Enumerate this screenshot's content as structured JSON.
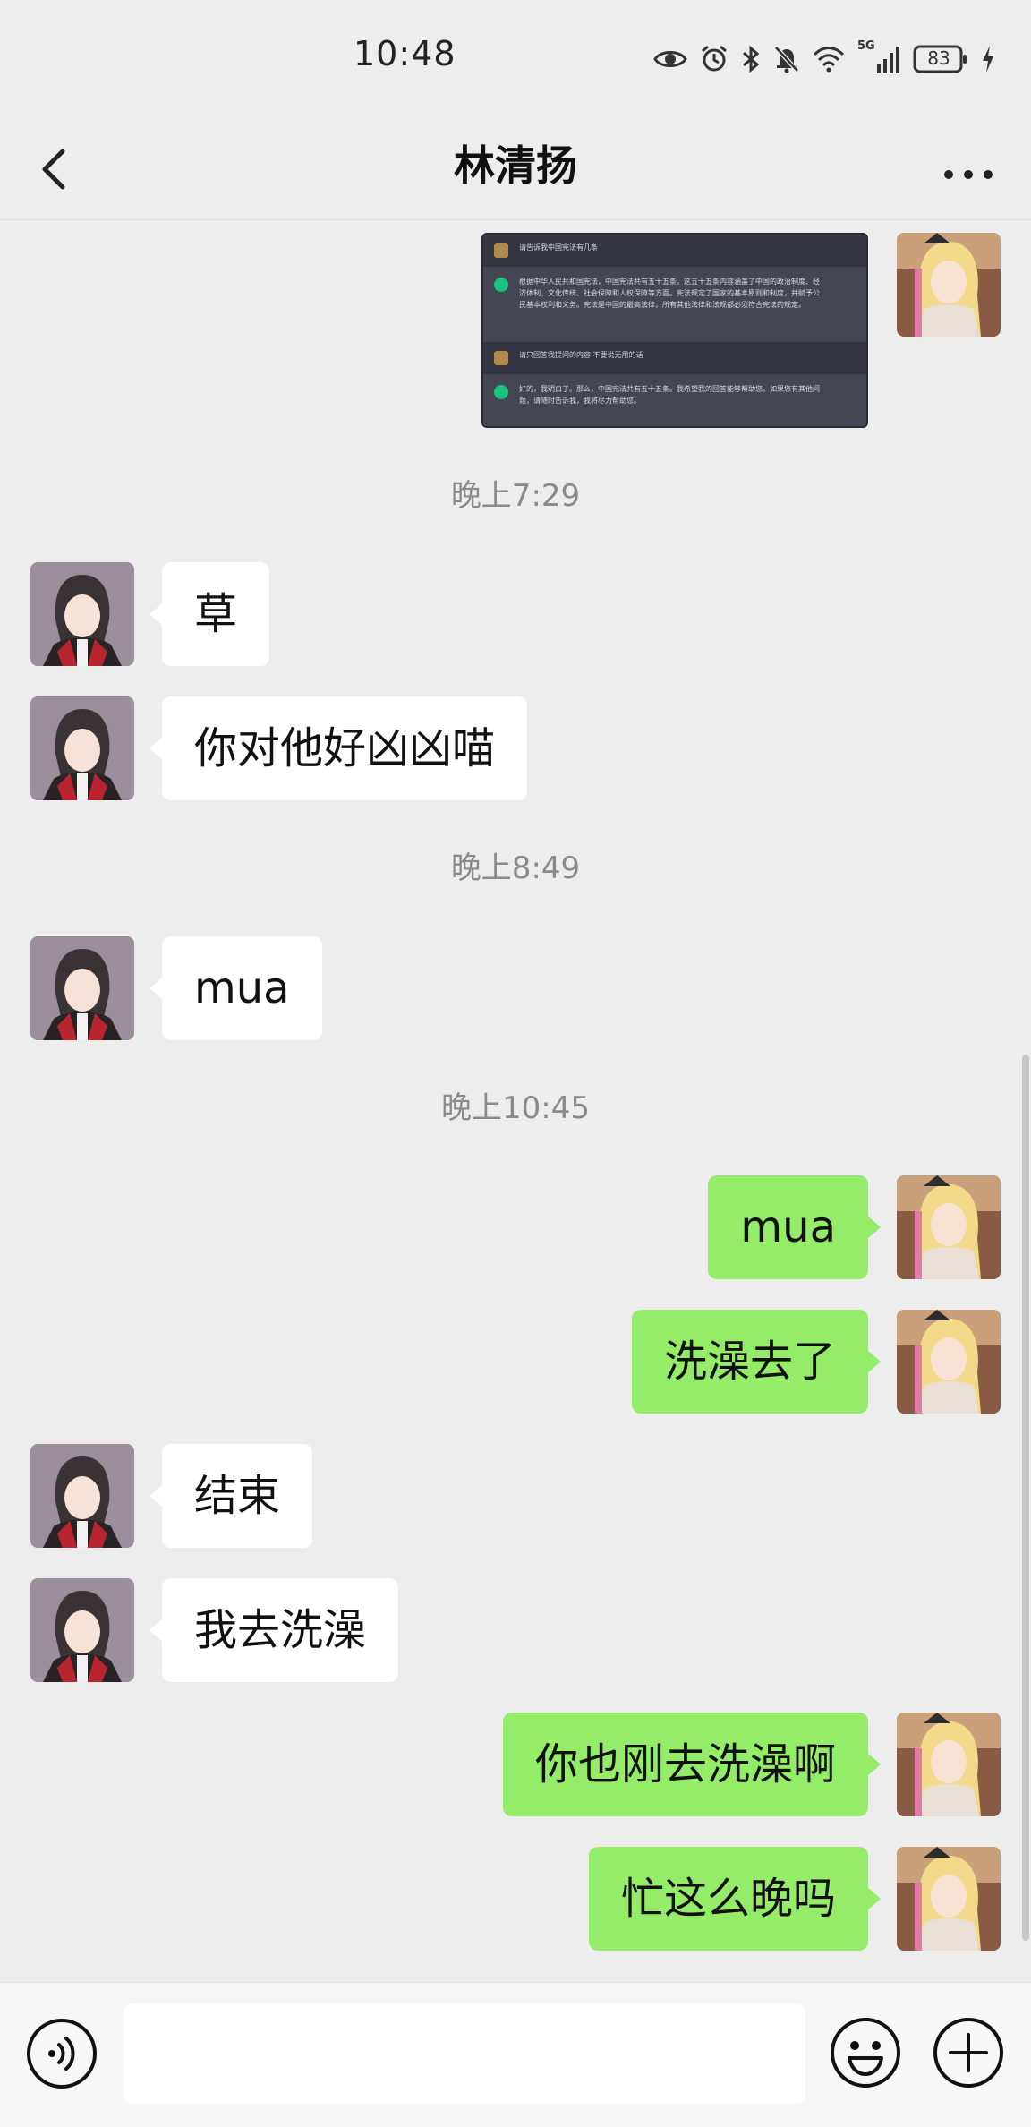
{
  "status_bar": {
    "time": "10:48",
    "battery": "83",
    "network_label": "5G"
  },
  "header": {
    "title": "林清扬"
  },
  "messages": {
    "image_message": {
      "q1": "请告诉我中国宪法有几条",
      "a1": "根据中华人民共和国宪法，中国宪法共有五十五条。这五十五条内容涵盖了中国的政治制度、经济体制、文化传统、社会保障和人权保障等方面。宪法规定了国家的基本原则和制度，并赋予公民基本权利和义务。宪法是中国的最高法律，所有其他法律和法规都必须符合宪法的规定。",
      "q2": "请只回答我提问的内容 不要说无用的话",
      "a2": "好的，我明白了。那么，中国宪法共有五十五条。我希望我的回答能够帮助您。如果您有其他问题，请随时告诉我，我将尽力帮助您。"
    },
    "ts1": "晚上7:29",
    "m1": "草",
    "m2": "你对他好凶凶喵",
    "ts2": "晚上8:49",
    "m3": "mua",
    "ts3": "晚上10:45",
    "m4": "mua",
    "m5": "洗澡去了",
    "m6": "结束",
    "m7": "我去洗澡",
    "m8": "你也刚去洗澡啊",
    "m9": "忙这么晚吗"
  },
  "input": {
    "value": ""
  },
  "colors": {
    "background": "#ededed",
    "outgoing_bubble": "#95ec69",
    "incoming_bubble": "#ffffff",
    "timestamp_text": "#8a8a8a"
  }
}
